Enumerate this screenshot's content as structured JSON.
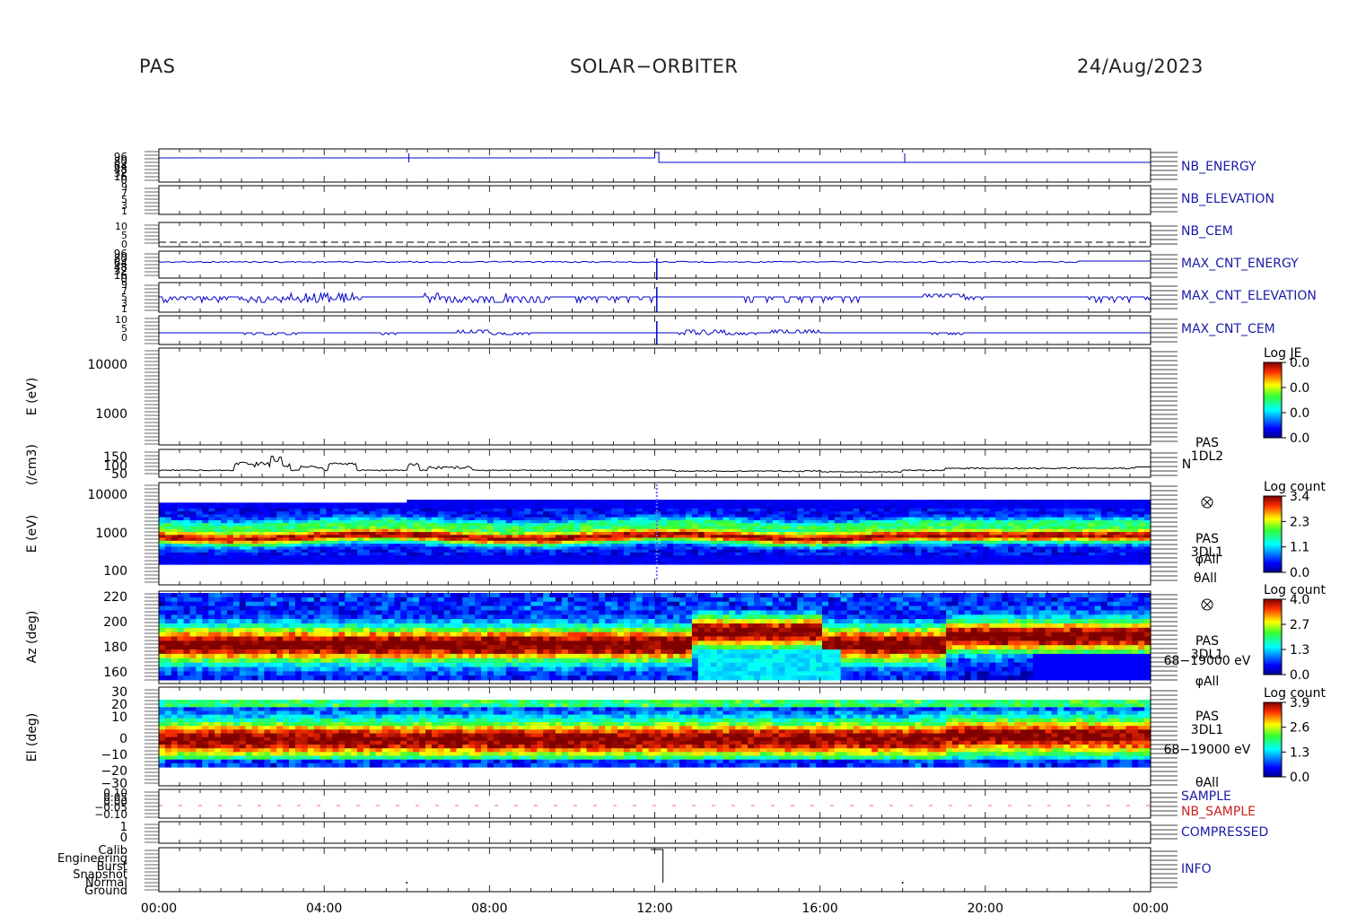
{
  "header": {
    "instrument": "PAS",
    "mission": "SOLAR−ORBITER",
    "date": "24/Aug/2023"
  },
  "chart_data": {
    "type": "heatmap",
    "x_ticks": [
      "00:00",
      "04:00",
      "08:00",
      "12:00",
      "16:00",
      "20:00",
      "00:00"
    ],
    "panels": [
      {
        "id": "nb_energy",
        "kind": "line",
        "label": "NB_ENERGY",
        "ticks": [
          "96",
          "80",
          "64",
          "48",
          "32",
          "16",
          "0"
        ]
      },
      {
        "id": "nb_elevation",
        "kind": "line",
        "label": "NB_ELEVATION",
        "ticks": [
          "9",
          "7",
          "5",
          "3",
          "1"
        ]
      },
      {
        "id": "nb_cem",
        "kind": "line",
        "label": "NB_CEM",
        "ticks": [
          "10",
          "5",
          "0"
        ]
      },
      {
        "id": "max_cnt_energy",
        "kind": "line",
        "label": "MAX_CNT_ENERGY",
        "ticks": [
          "96",
          "80",
          "64",
          "48",
          "32",
          "16",
          "0"
        ]
      },
      {
        "id": "max_cnt_elevation",
        "kind": "line",
        "label": "MAX_CNT_ELEVATION",
        "ticks": [
          "9",
          "7",
          "5",
          "3",
          "1"
        ]
      },
      {
        "id": "max_cnt_cem",
        "kind": "line",
        "label": "MAX_CNT_CEM",
        "ticks": [
          "10",
          "5",
          "0"
        ]
      },
      {
        "id": "je_spectrogram",
        "kind": "spectrogram",
        "ylabel": "E (eV)",
        "ticks": [
          "10000",
          "1000"
        ],
        "colorbar": {
          "title": "Log JE",
          "ticks": [
            "0.0",
            "0.0",
            "0.0",
            "0.0"
          ]
        }
      },
      {
        "id": "density",
        "kind": "line",
        "ylabel": "(/cm3)",
        "ticks": [
          "150",
          "100",
          "50"
        ],
        "labels": [
          "PAS",
          "1DL2",
          "N"
        ]
      },
      {
        "id": "energy_spectrogram",
        "kind": "spectrogram",
        "ylabel": "E (eV)",
        "ticks": [
          "10000",
          "1000",
          "100"
        ],
        "labels": [
          "PAS",
          "3DL1",
          "φAll",
          "θAll"
        ],
        "colorbar": {
          "title": "Log count",
          "ticks": [
            "3.4",
            "2.3",
            "1.1",
            "0.0"
          ]
        }
      },
      {
        "id": "azimuth_spectrogram",
        "kind": "spectrogram",
        "ylabel": "Az (deg)",
        "ticks": [
          "220",
          "200",
          "180",
          "160"
        ],
        "labels": [
          "PAS",
          "3DL1",
          "68−19000 eV",
          "φAll"
        ],
        "colorbar": {
          "title": "Log count",
          "ticks": [
            "4.0",
            "2.7",
            "1.3",
            "0.0"
          ]
        }
      },
      {
        "id": "elevation_spectrogram",
        "kind": "spectrogram",
        "ylabel": "El (deg)",
        "ticks": [
          "30",
          "20",
          "10",
          "0",
          "−10",
          "−20",
          "−30"
        ],
        "labels": [
          "PAS",
          "3DL1",
          "68−19000 eV",
          "θAll"
        ],
        "colorbar": {
          "title": "Log count",
          "ticks": [
            "3.9",
            "2.6",
            "1.3",
            "0.0"
          ]
        }
      },
      {
        "id": "sample",
        "kind": "line",
        "labels": [
          "SAMPLE",
          "NB_SAMPLE"
        ],
        "ticks": [
          "0.10",
          "0.05",
          "0.00",
          "−0.05",
          "−0.10"
        ]
      },
      {
        "id": "compressed",
        "kind": "line",
        "label": "COMPRESSED",
        "ticks": [
          "1",
          "0"
        ]
      },
      {
        "id": "info",
        "kind": "line",
        "label": "INFO",
        "ticks": [
          "Calib",
          "Engineering",
          "Burst",
          "Snapshot",
          "Normal",
          "Ground"
        ]
      }
    ],
    "grid": false
  },
  "colors": {
    "label_blue": "#1a1aa8",
    "label_red": "#cc2222",
    "line_blue": "#0000cc",
    "axis": "#000000"
  }
}
